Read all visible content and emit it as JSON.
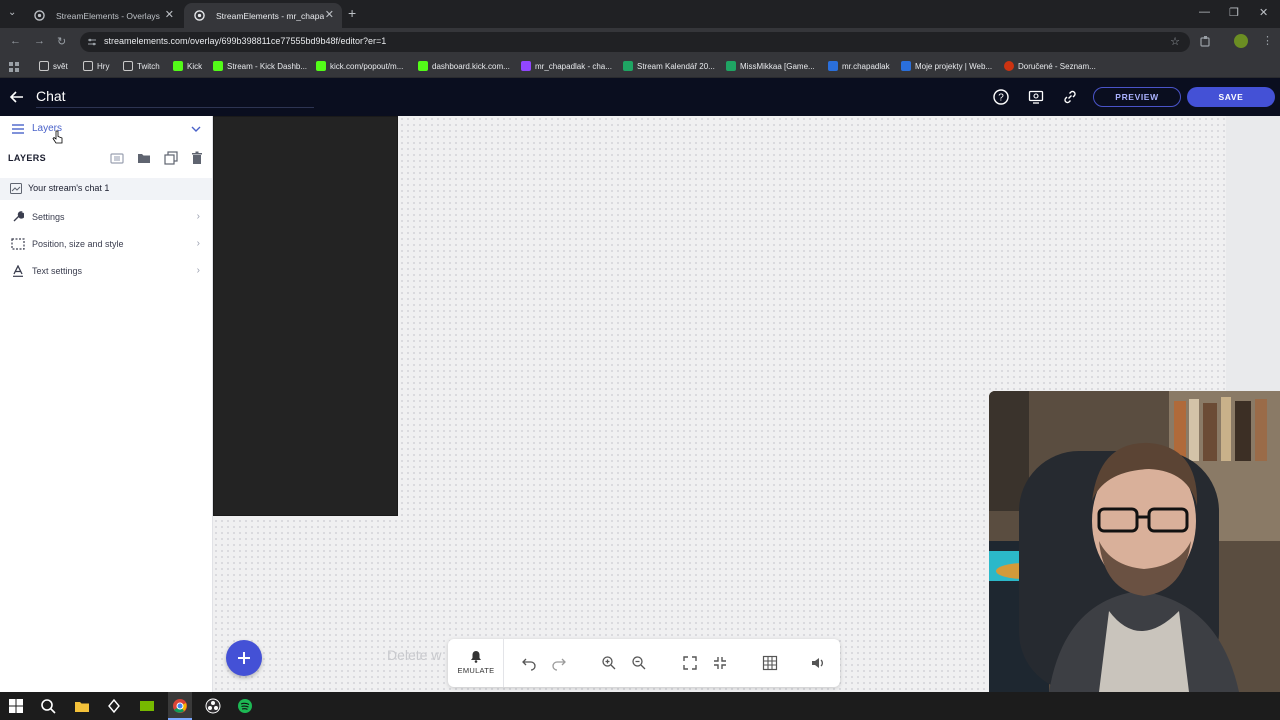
{
  "browser": {
    "tabs": [
      {
        "title": "StreamElements - Overlays",
        "active": false
      },
      {
        "title": "StreamElements - mr_chapadlak",
        "active": true
      }
    ],
    "url": "streamelements.com/overlay/699b398811ce77555bd9b48f/editor?er=1",
    "bookmarks": [
      {
        "label": "svět",
        "icon": "folder-icon",
        "color": "#c9c9c9"
      },
      {
        "label": "Hry",
        "icon": "folder-icon",
        "color": "#c9c9c9"
      },
      {
        "label": "Twitch",
        "icon": "folder-icon",
        "color": "#c9c9c9"
      },
      {
        "label": "Kick",
        "icon": "kick-icon",
        "color": "#53fc18"
      },
      {
        "label": "Stream - Kick Dashb...",
        "icon": "kick-icon",
        "color": "#53fc18"
      },
      {
        "label": "kick.com/popout/m...",
        "icon": "kick-icon",
        "color": "#53fc18"
      },
      {
        "label": "dashboard.kick.com...",
        "icon": "kick-icon",
        "color": "#53fc18"
      },
      {
        "label": "mr_chapadlak - cha...",
        "icon": "twitch-icon",
        "color": "#9146ff"
      },
      {
        "label": "Stream Kalendář 20...",
        "icon": "sheets-icon",
        "color": "#1fa463"
      },
      {
        "label": "MissMikkaa [Game...",
        "icon": "sheets-icon",
        "color": "#1fa463"
      },
      {
        "label": "mr.chapadlak",
        "icon": "web-icon",
        "color": "#2a6fdb"
      },
      {
        "label": "Moje projekty | Web...",
        "icon": "web-icon",
        "color": "#2a6fdb"
      },
      {
        "label": "Doručené - Seznam...",
        "icon": "seznam-icon",
        "color": "#cc3311"
      }
    ]
  },
  "header": {
    "title": "Chat",
    "preview_label": "PREVIEW",
    "save_label": "SAVE"
  },
  "leftpanel": {
    "toggle_label": "Layers",
    "heading": "LAYERS",
    "layer_name": "Your stream's chat 1",
    "sections": [
      {
        "label": "Settings",
        "icon": "wrench-icon"
      },
      {
        "label": "Position, size and style",
        "icon": "position-icon"
      },
      {
        "label": "Text settings",
        "icon": "text-icon"
      }
    ]
  },
  "canvas": {
    "ghost_text": "Delete w"
  },
  "toolbar": {
    "emulate_label": "EMULATE"
  },
  "colors": {
    "accent": "#4451d6",
    "header_bg": "#0a0e1f",
    "widget_bg": "#232323"
  }
}
